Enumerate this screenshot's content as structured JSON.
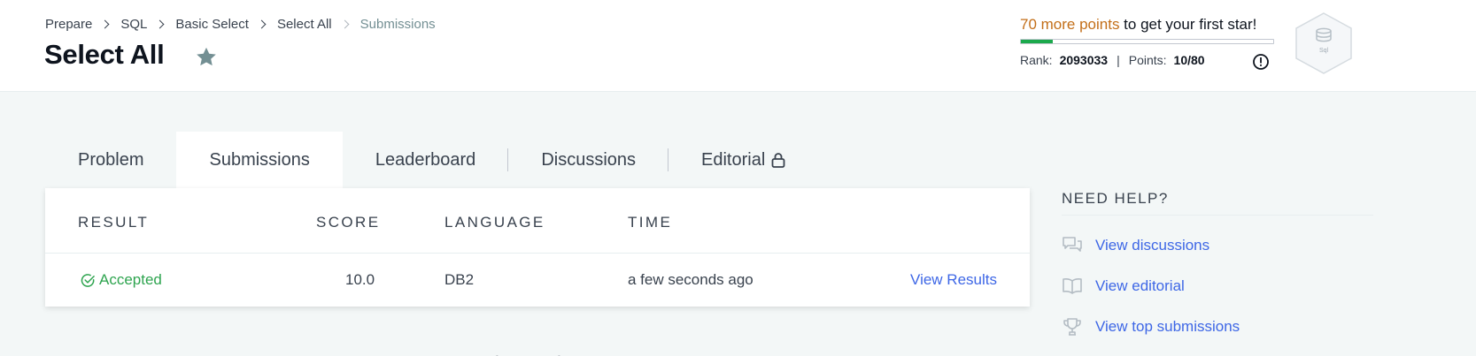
{
  "breadcrumb": {
    "items": [
      "Prepare",
      "SQL",
      "Basic Select",
      "Select All"
    ],
    "current": "Submissions"
  },
  "page_title": "Select All",
  "progress": {
    "highlight": "70 more points",
    "rest": " to get your first star!",
    "fraction": 0.125,
    "rank_label": "Rank:",
    "rank_value": "2093033",
    "points_label": "Points:",
    "points_value": "10/80",
    "badge_label": "Sql"
  },
  "tabs": [
    {
      "label": "Problem"
    },
    {
      "label": "Submissions"
    },
    {
      "label": "Leaderboard"
    },
    {
      "label": "Discussions"
    },
    {
      "label": "Editorial"
    }
  ],
  "table": {
    "headers": [
      "RESULT",
      "SCORE",
      "LANGUAGE",
      "TIME"
    ],
    "rows": [
      {
        "result": "Accepted",
        "score": "10.0",
        "language": "DB2",
        "time": "a few seconds ago",
        "action": "View Results"
      }
    ]
  },
  "help": {
    "title": "NEED HELP?",
    "links": [
      "View discussions",
      "View editorial",
      "View top submissions"
    ]
  },
  "colors": {
    "accent": "#3e67e6",
    "success": "#2ea44f",
    "highlight": "#c36f19",
    "progress": "#1ba94c"
  },
  "icons": [
    "chevron-right-icon",
    "star-icon",
    "info-icon",
    "database-badge-icon",
    "lock-icon",
    "check-circle-icon",
    "chat-icon",
    "book-icon",
    "trophy-icon"
  ]
}
